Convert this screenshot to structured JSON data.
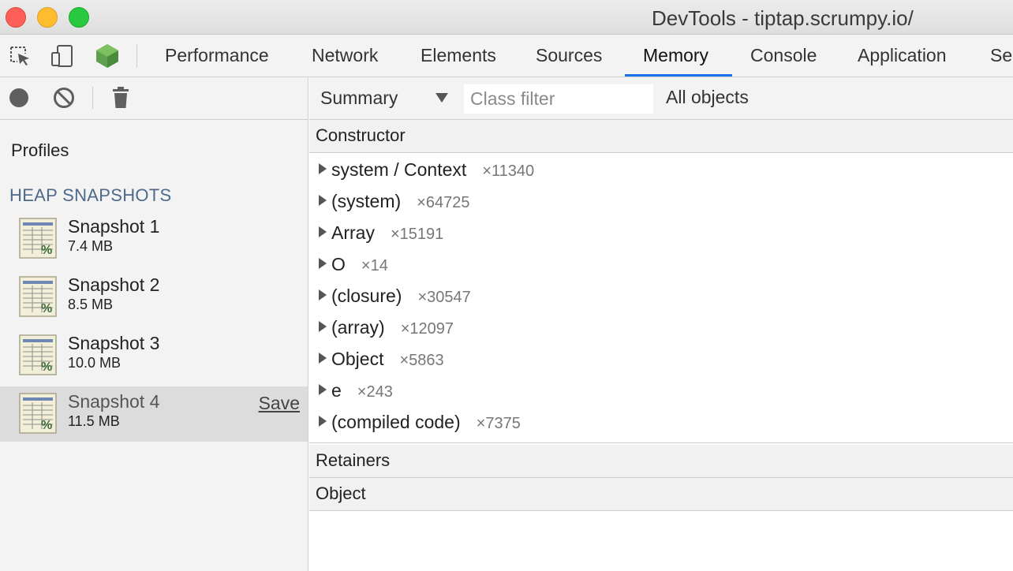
{
  "window": {
    "title": "DevTools - tiptap.scrumpy.io/"
  },
  "toolbar": {
    "icons": [
      "inspect-element-icon",
      "device-toolbar-icon",
      "vue-devtools-icon"
    ],
    "tabs": [
      {
        "label": "Performance",
        "active": false
      },
      {
        "label": "Network",
        "active": false
      },
      {
        "label": "Elements",
        "active": false
      },
      {
        "label": "Sources",
        "active": false
      },
      {
        "label": "Memory",
        "active": true
      },
      {
        "label": "Console",
        "active": false
      },
      {
        "label": "Application",
        "active": false
      },
      {
        "label": "Se",
        "active": false
      }
    ],
    "accent_color": "#1a73e8"
  },
  "left_panel": {
    "toolbar_icons": [
      "record-icon",
      "clear-icon",
      "trash-icon"
    ],
    "profiles_title": "Profiles",
    "section_title": "HEAP SNAPSHOTS",
    "snapshots": [
      {
        "name": "Snapshot 1",
        "size": "7.4 MB"
      },
      {
        "name": "Snapshot 2",
        "size": "8.5 MB"
      },
      {
        "name": "Snapshot 3",
        "size": "10.0 MB"
      },
      {
        "name": "Snapshot 4",
        "size": "11.5 MB",
        "selected": true,
        "action": "Save"
      }
    ]
  },
  "right_panel": {
    "view": "Summary",
    "class_filter_placeholder": "Class filter",
    "objects_filter": "All objects",
    "constructor_header": "Constructor",
    "rows": [
      {
        "name": "system / Context",
        "count": "×11340"
      },
      {
        "name": "(system)",
        "count": "×64725"
      },
      {
        "name": "Array",
        "count": "×15191"
      },
      {
        "name": "O",
        "count": "×14"
      },
      {
        "name": "(closure)",
        "count": "×30547"
      },
      {
        "name": "(array)",
        "count": "×12097"
      },
      {
        "name": "Object",
        "count": "×5863"
      },
      {
        "name": "e",
        "count": "×243"
      },
      {
        "name": "(compiled code)",
        "count": "×7375"
      }
    ],
    "retainers_header": "Retainers",
    "object_header": "Object"
  }
}
